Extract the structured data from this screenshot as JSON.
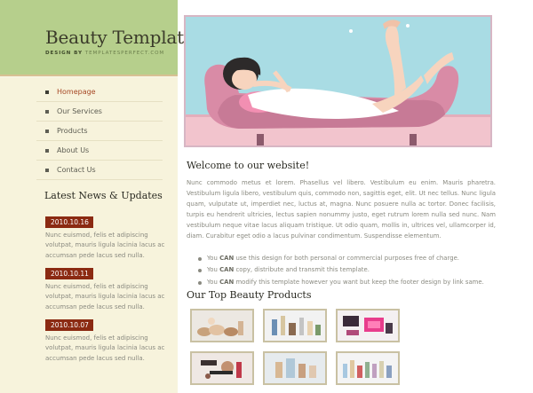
{
  "header": {
    "title": "Beauty Template",
    "tagline_prefix": "DESIGN BY ",
    "tagline_site": "TEMPLATESPERFECT.COM"
  },
  "nav": {
    "items": [
      {
        "label": "Homepage",
        "active": true
      },
      {
        "label": "Our Services"
      },
      {
        "label": "Products"
      },
      {
        "label": "About Us"
      },
      {
        "label": "Contact Us"
      }
    ]
  },
  "news": {
    "heading": "Latest News & Updates",
    "items": [
      {
        "date": "2010.10.16",
        "text": "Nunc euismod, felis et adipiscing volutpat, mauris ligula lacinia lacus ac accumsan pede lacus sed nulla."
      },
      {
        "date": "2010.10.11",
        "text": "Nunc euismod, felis et adipiscing volutpat, mauris ligula lacinia lacus ac accumsan pede lacus sed nulla."
      },
      {
        "date": "2010.10.07",
        "text": "Nunc euismod, felis et adipiscing volutpat, mauris ligula lacinia lacus ac accumsan pede lacus sed nulla."
      }
    ]
  },
  "main": {
    "welcome_heading": "Welcome to our website!",
    "intro": "Nunc commodo metus et lorem. Phasellus vel libero. Vestibulum eu enim. Mauris pharetra. Vestibulum ligula libero, vestibulum quis, commodo non, sagittis eget, elit. Ut nec tellus. Nunc ligula quam, vulputate ut, imperdiet nec, luctus at, magna. Nunc posuere nulla ac tortor. Donec facilisis, turpis eu hendrerit ultricies, lectus sapien nonummy justo, eget rutrum lorem nulla sed nunc. Nam vestibulum neque vitae lacus aliquam tristique. Ut odio quam, mollis in, ultrices vel, ullamcorper id, diam. Curabitur eget odio a lacus pulvinar condimentum. Suspendisse elementum.",
    "bullets": [
      {
        "pre": "You ",
        "strong": "CAN",
        "post": " use this design for both personal or commercial purposes free of charge."
      },
      {
        "pre": "You ",
        "strong": "CAN",
        "post": " copy, distribute and transmit this template."
      },
      {
        "pre": "You ",
        "strong": "CAN",
        "post": " modify this template however you want but keep the footer design by link same."
      }
    ],
    "products_heading": "Our Top Beauty Products"
  },
  "colors": {
    "header_green": "#b6cf8c",
    "sidebar_cream": "#f7f3dc",
    "date_badge": "#8b2a12",
    "active_nav": "#a64724",
    "hero_sky": "#a9dce4",
    "sofa_pink": "#d98ba6"
  },
  "icons": {
    "nav_bullet": "square-bullet-icon",
    "list_bullet": "round-bullet-icon"
  }
}
